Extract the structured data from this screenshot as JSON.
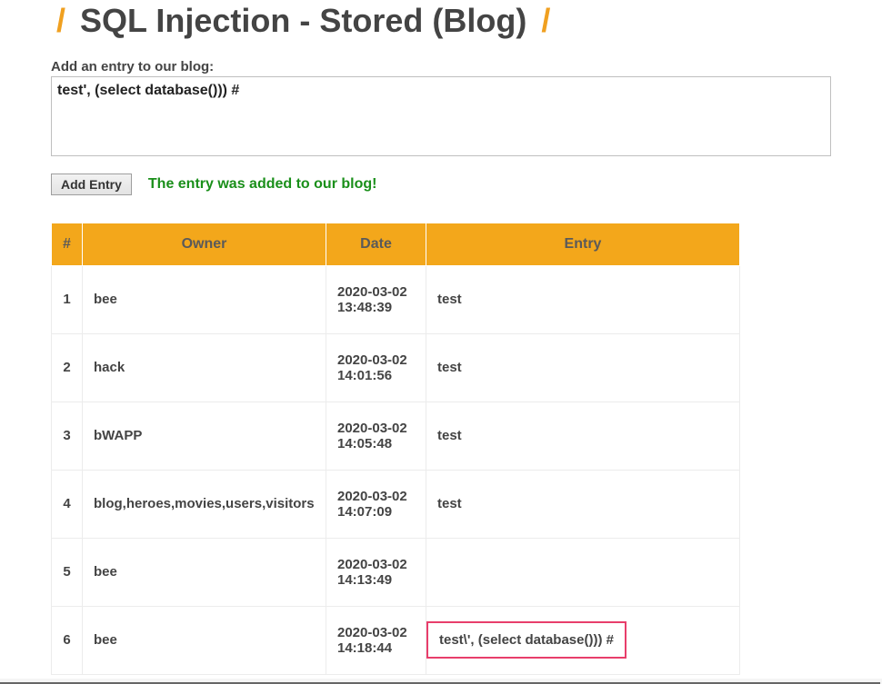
{
  "title_slash": "/",
  "title_text": "SQL Injection - Stored (Blog)",
  "form": {
    "label": "Add an entry to our blog:",
    "textarea_value": "test', (select database())) #",
    "button_label": "Add Entry",
    "status_text": "The entry was added to our blog!"
  },
  "table": {
    "headers": {
      "idx": "#",
      "owner": "Owner",
      "date": "Date",
      "entry": "Entry"
    },
    "rows": [
      {
        "idx": "1",
        "owner": "bee",
        "date": "2020-03-02 13:48:39",
        "entry": "test",
        "highlight": false
      },
      {
        "idx": "2",
        "owner": "hack",
        "date": "2020-03-02 14:01:56",
        "entry": "test",
        "highlight": false
      },
      {
        "idx": "3",
        "owner": "bWAPP",
        "date": "2020-03-02 14:05:48",
        "entry": "test",
        "highlight": false
      },
      {
        "idx": "4",
        "owner": "blog,heroes,movies,users,visitors",
        "date": "2020-03-02 14:07:09",
        "entry": "test",
        "highlight": false
      },
      {
        "idx": "5",
        "owner": "bee",
        "date": "2020-03-02 14:13:49",
        "entry": "",
        "highlight": false
      },
      {
        "idx": "6",
        "owner": "bee",
        "date": "2020-03-02 14:18:44",
        "entry": "test\\', (select database())) #",
        "highlight": true
      }
    ]
  }
}
